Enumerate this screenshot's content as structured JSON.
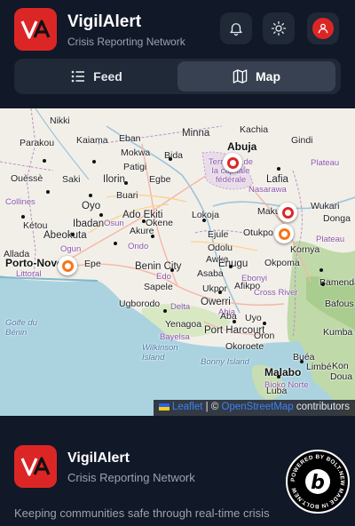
{
  "header": {
    "title": "VigilAlert",
    "subtitle": "Crisis Reporting Network",
    "logo_text": "VA",
    "bell_icon": "bell-icon",
    "theme_icon": "sun-icon",
    "user_icon": "user-icon"
  },
  "tabs": [
    {
      "label": "Feed",
      "icon": "list-icon"
    },
    {
      "label": "Map",
      "icon": "map-icon",
      "active": true
    }
  ],
  "map": {
    "places": [
      {
        "name": "Nikki"
      },
      {
        "name": "Parakou"
      },
      {
        "name": "Kaiama"
      },
      {
        "name": "Eban"
      },
      {
        "name": "Mokwa"
      },
      {
        "name": "Minna"
      },
      {
        "name": "Kachia"
      },
      {
        "name": "Bida"
      },
      {
        "name": "Abuja"
      },
      {
        "name": "Territoire de la capitale fédérale"
      },
      {
        "name": "Gindi"
      },
      {
        "name": "Plateau"
      },
      {
        "name": "Ouèssè"
      },
      {
        "name": "Saki"
      },
      {
        "name": "Ilorin"
      },
      {
        "name": "Egbe"
      },
      {
        "name": "Patigi"
      },
      {
        "name": "Lafia"
      },
      {
        "name": "Nasarawa"
      },
      {
        "name": "Collines"
      },
      {
        "name": "Oyo"
      },
      {
        "name": "Buari"
      },
      {
        "name": "Kétou"
      },
      {
        "name": "Ibadan"
      },
      {
        "name": "Ado Ekiti"
      },
      {
        "name": "Okene"
      },
      {
        "name": "Lokoja"
      },
      {
        "name": "Makurdi"
      },
      {
        "name": "Wukari"
      },
      {
        "name": "Donga"
      },
      {
        "name": "Plateau"
      },
      {
        "name": "Abeokuta"
      },
      {
        "name": "Osun"
      },
      {
        "name": "Akure"
      },
      {
        "name": "Ejule"
      },
      {
        "name": "Otukpo"
      },
      {
        "name": "Ondo"
      },
      {
        "name": "Odolu"
      },
      {
        "name": "Kornya"
      },
      {
        "name": "Allada"
      },
      {
        "name": "Ogun"
      },
      {
        "name": "Porto-Novo"
      },
      {
        "name": "Epe"
      },
      {
        "name": "Benin City"
      },
      {
        "name": "Awka"
      },
      {
        "name": "Enugu"
      },
      {
        "name": "Okpoma"
      },
      {
        "name": "Littoral"
      },
      {
        "name": "Asaba"
      },
      {
        "name": "Edo"
      },
      {
        "name": "Ebonyi"
      },
      {
        "name": "Sapele"
      },
      {
        "name": "Ukpor"
      },
      {
        "name": "Afikpo"
      },
      {
        "name": "Cross River"
      },
      {
        "name": "Ugborodo"
      },
      {
        "name": "Delta"
      },
      {
        "name": "Owerri"
      },
      {
        "name": "Abia"
      },
      {
        "name": "Bamenda"
      },
      {
        "name": "Golfe du Bénin"
      },
      {
        "name": "Aba"
      },
      {
        "name": "Uyo"
      },
      {
        "name": "Bafous"
      },
      {
        "name": "Yenagoa"
      },
      {
        "name": "Port Harcourt"
      },
      {
        "name": "Bayelsa"
      },
      {
        "name": "Okoroete"
      },
      {
        "name": "Oron"
      },
      {
        "name": "Kumba"
      },
      {
        "name": "Wilkinson Island"
      },
      {
        "name": "Bonny Island"
      },
      {
        "name": "Buéa"
      },
      {
        "name": "Limbé"
      },
      {
        "name": "Malabo"
      },
      {
        "name": "Bioko Norte"
      },
      {
        "name": "Luba"
      },
      {
        "name": "Doua"
      },
      {
        "name": "Kon"
      }
    ],
    "attribution": {
      "leaflet": "Leaflet",
      "separator": "| ©",
      "osm": "OpenStreetMap",
      "suffix": "contributors"
    },
    "markers": [
      {
        "label": "abuja-incident",
        "color": "#dc2626"
      },
      {
        "label": "makurdi-incident",
        "color": "#dc2626"
      },
      {
        "label": "otukpo-incident",
        "color": "#f97316"
      },
      {
        "label": "porto-novo-incident",
        "color": "#f97316"
      }
    ]
  },
  "footer": {
    "title": "VigilAlert",
    "subtitle": "Crisis Reporting Network",
    "description": "Keeping communities safe through real-time crisis reporting and Al-powered alerts across Africa.",
    "badge_text": "POWERED BY BOLT.NEW MADE IN BOLT.NEW"
  },
  "colors": {
    "accent": "#dc2626",
    "warning": "#f97316",
    "background": "#111827",
    "panel": "#1f2937"
  }
}
